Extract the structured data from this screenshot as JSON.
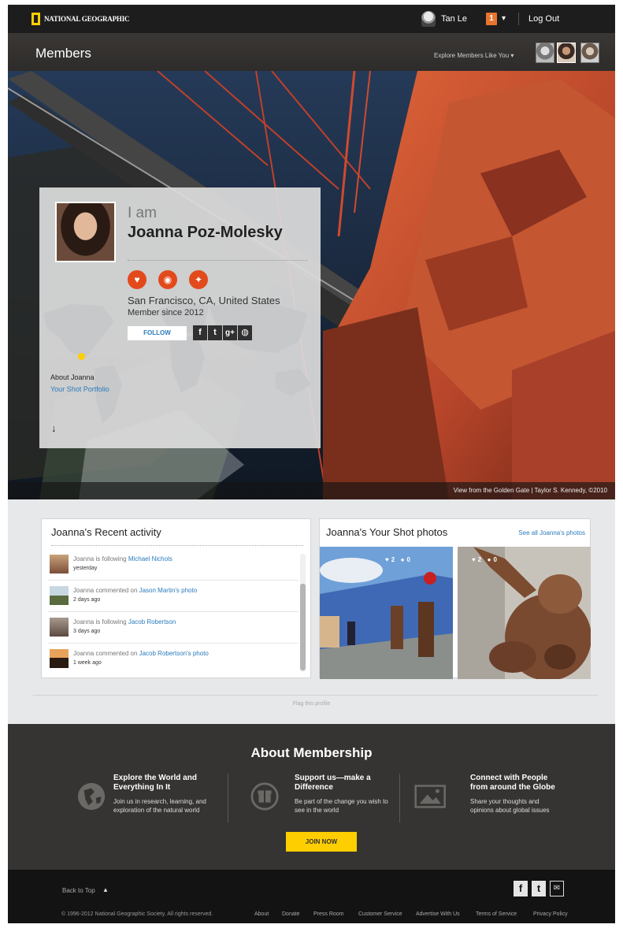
{
  "topbar": {
    "logo_text": "NATIONAL GEOGRAPHIC",
    "user_name": "Tan Le",
    "notification_count": "1",
    "notification_caret": "▾",
    "logout": "Log Out"
  },
  "members_bar": {
    "title": "Members",
    "explore_label": "Explore Members Like You ▾"
  },
  "hero": {
    "caption": "View from the Golden Gate | Taylor S. Kennedy, ©2010"
  },
  "profile": {
    "intro": "I am",
    "name": "Joanna Poz-Molesky",
    "location": "San Francisco, CA, United States",
    "member_since": "Member since 2012",
    "follow": "FOLLOW",
    "about": "About Joanna",
    "portfolio_link": "Your Shot Portfolio",
    "badges": [
      "heart-badge-icon",
      "camera-badge-icon",
      "bird-badge-icon"
    ],
    "social": [
      "f",
      "t",
      "g+",
      "globe"
    ],
    "scroll_arrow": "↓"
  },
  "activity": {
    "title": "Joanna's Recent activity",
    "items": [
      {
        "prefix": "Joanna is following ",
        "link": "Michael Nichols",
        "time": "yesterday"
      },
      {
        "prefix": "Joanna commented on ",
        "link": "Jason Martin's photo",
        "time": "2 days ago"
      },
      {
        "prefix": "Joanna is following ",
        "link": "Jacob Robertson",
        "time": "3 days ago"
      },
      {
        "prefix": "Joanna commented on ",
        "link": "Jacob Robertson's photo",
        "time": "1 week ago"
      }
    ]
  },
  "photos": {
    "title": "Joanna's Your Shot photos",
    "see_all": "See all Joanna's photos",
    "items": [
      {
        "likes": "2",
        "comments": "0"
      },
      {
        "likes": "2",
        "comments": "0"
      }
    ]
  },
  "flag": "Flag this profile",
  "about_membership": {
    "title": "About Membership",
    "columns": [
      {
        "head1": "Explore the World and",
        "head2": "Everything In It",
        "body1": "Join us in research, learning, and",
        "body2": "exploration of the natural world"
      },
      {
        "head1": "Support us—make a",
        "head2": "Difference",
        "body1": "Be part of the change you wish to",
        "body2": "see in the world"
      },
      {
        "head1": "Connect with People",
        "head2": "from around the Globe",
        "body1": "Share your thoughts and",
        "body2": "opinions about global issues"
      }
    ],
    "join": "JOIN NOW"
  },
  "footer": {
    "back_to_top": "Back to Top",
    "back_arrow": "▲",
    "social": [
      "f",
      "t",
      "✉"
    ],
    "copyright": "© 1996-2012 National Geographic Society. All rights reserved.",
    "links": [
      "About",
      "Donate",
      "Press Room",
      "Customer Service",
      "Advertise With Us",
      "Terms of Service",
      "Privacy Policy"
    ]
  },
  "colors": {
    "accent_orange": "#e24a1c",
    "link_blue": "#2a7bbd",
    "brand_yellow": "#ffce00"
  }
}
